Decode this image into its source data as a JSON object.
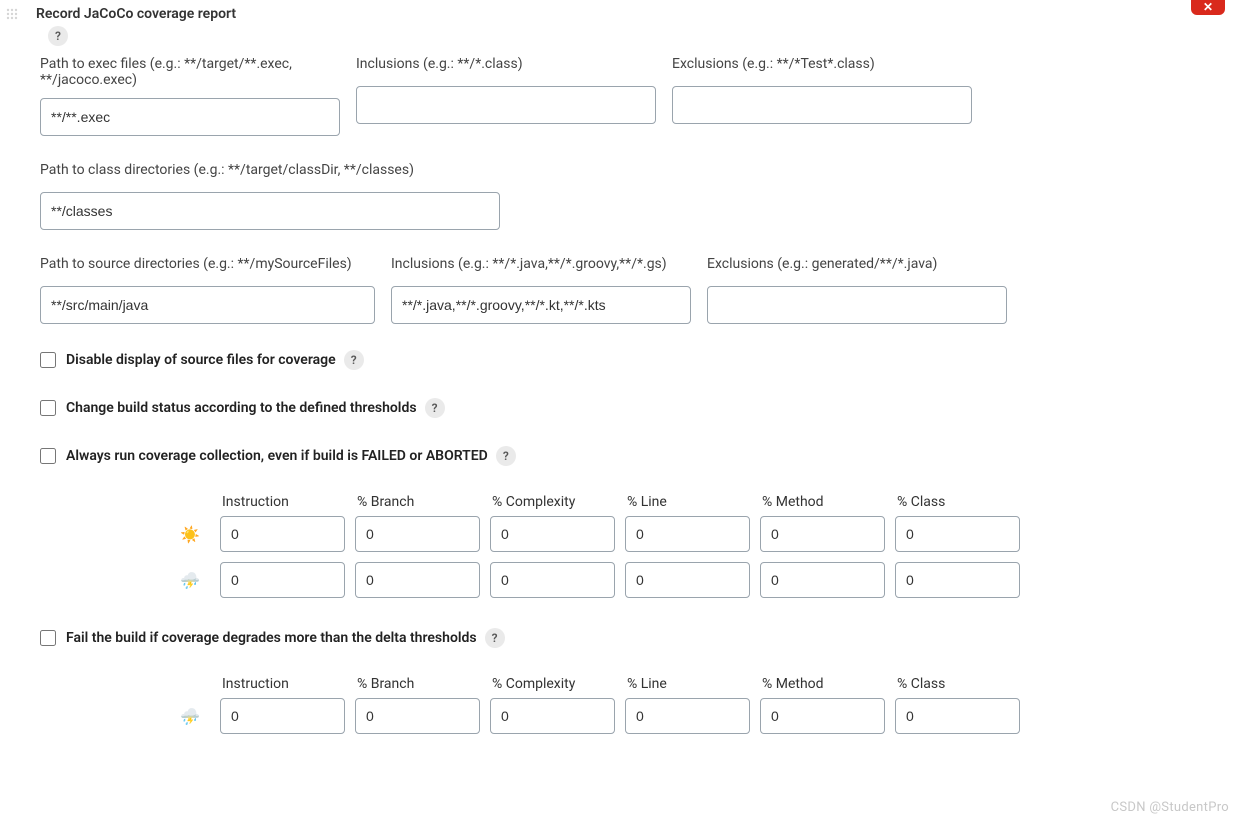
{
  "section": {
    "title": "Record JaCoCo coverage report",
    "help": "?",
    "delete_label": "✕"
  },
  "row1": {
    "exec_label": "Path to exec files (e.g.: **/target/**.exec, **/jacoco.exec)",
    "exec_value": "**/**.exec",
    "incl_label": "Inclusions (e.g.: **/*.class)",
    "incl_value": "",
    "excl_label": "Exclusions (e.g.: **/*Test*.class)",
    "excl_value": ""
  },
  "row2": {
    "classdir_label": "Path to class directories (e.g.: **/target/classDir, **/classes)",
    "classdir_value": "**/classes"
  },
  "row3": {
    "srcdir_label": "Path to source directories (e.g.: **/mySourceFiles)",
    "srcdir_value": "**/src/main/java",
    "incl_label": "Inclusions (e.g.: **/*.java,**/*.groovy,**/*.gs)",
    "incl_value": "**/*.java,**/*.groovy,**/*.kt,**/*.kts",
    "excl_label": "Exclusions (e.g.: generated/**/*.java)",
    "excl_value": ""
  },
  "checks": {
    "disable_src": "Disable display of source files for coverage",
    "change_status": "Change build status according to the defined thresholds",
    "always_run": "Always run coverage collection, even if build is FAILED or ABORTED",
    "fail_degrades": "Fail the build if coverage degrades more than the delta thresholds",
    "help": "?"
  },
  "thresholds": {
    "headers": {
      "instruction": "Instruction",
      "branch": "% Branch",
      "complexity": "% Complexity",
      "line": "% Line",
      "method": "% Method",
      "class": "% Class"
    },
    "sunny_icon": "☀️",
    "stormy_icon": "⛈️",
    "sunny": {
      "instruction": "0",
      "branch": "0",
      "complexity": "0",
      "line": "0",
      "method": "0",
      "class": "0"
    },
    "stormy": {
      "instruction": "0",
      "branch": "0",
      "complexity": "0",
      "line": "0",
      "method": "0",
      "class": "0"
    }
  },
  "delta": {
    "stormy_icon": "⛈️",
    "stormy": {
      "instruction": "0",
      "branch": "0",
      "complexity": "0",
      "line": "0",
      "method": "0",
      "class": "0"
    }
  },
  "watermark": "CSDN @StudentPro"
}
